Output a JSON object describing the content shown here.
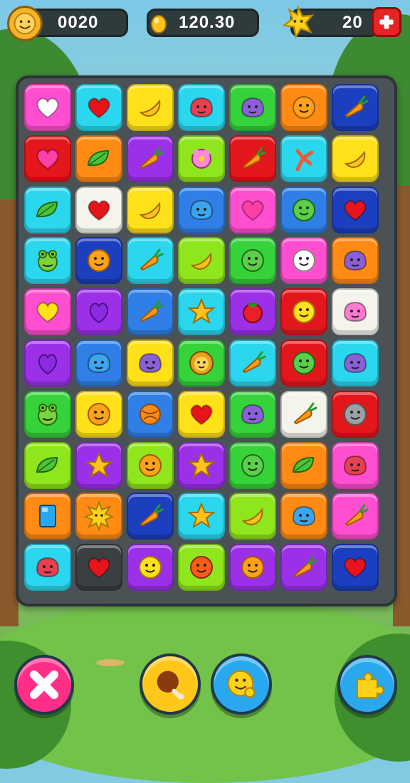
{
  "hud": {
    "score": "0020",
    "coins": "120.30",
    "moves": "20"
  },
  "colors": {
    "pink": "#ff4fd0",
    "cyan": "#2bd7ef",
    "yellow": "#ffe11a",
    "green": "#8fe61c",
    "orange": "#ff8a14",
    "navy": "#1c3fbf",
    "red": "#e3161c",
    "purple": "#9b30e8",
    "white": "#f4f4ec",
    "blue": "#2f7fe6",
    "dark": "#3a3f42",
    "lime": "#36d23a"
  },
  "grid": [
    [
      [
        "pink",
        "heart-white-icon"
      ],
      [
        "cyan",
        "heart-red-icon"
      ],
      [
        "yellow",
        "banana-icon"
      ],
      [
        "cyan",
        "red-blob-icon"
      ],
      [
        "lime",
        "purple-blob-icon"
      ],
      [
        "orange",
        "orange-face-icon"
      ],
      [
        "navy",
        "carrot-icon"
      ]
    ],
    [
      [
        "red",
        "heart-pink-icon"
      ],
      [
        "orange",
        "leaf-icon"
      ],
      [
        "purple",
        "carrot-icon"
      ],
      [
        "green",
        "flower-icon"
      ],
      [
        "red",
        "carrot-icon"
      ],
      [
        "cyan",
        "branch-icon"
      ],
      [
        "yellow",
        "banana-icon"
      ]
    ],
    [
      [
        "cyan",
        "leaf-icon"
      ],
      [
        "white",
        "heart-red-icon"
      ],
      [
        "yellow",
        "banana-icon"
      ],
      [
        "blue",
        "blue-blob-icon"
      ],
      [
        "pink",
        "heart-pink-icon"
      ],
      [
        "blue",
        "green-face-icon"
      ],
      [
        "navy",
        "heart-red-icon"
      ]
    ],
    [
      [
        "cyan",
        "frog-icon"
      ],
      [
        "navy",
        "orange-face-icon"
      ],
      [
        "cyan",
        "carrot-icon"
      ],
      [
        "green",
        "banana-icon"
      ],
      [
        "lime",
        "green-face-icon"
      ],
      [
        "pink",
        "white-face-icon"
      ],
      [
        "orange",
        "purple-blob-icon"
      ]
    ],
    [
      [
        "pink",
        "heart-yellow-icon"
      ],
      [
        "purple",
        "heart-purple-icon"
      ],
      [
        "blue",
        "carrot-icon"
      ],
      [
        "cyan",
        "star-icon"
      ],
      [
        "purple",
        "tomato-icon"
      ],
      [
        "red",
        "yellow-face-icon"
      ],
      [
        "white",
        "pink-blob-icon"
      ]
    ],
    [
      [
        "purple",
        "heart-purple-icon"
      ],
      [
        "blue",
        "blue-blob-icon"
      ],
      [
        "yellow",
        "purple-blob-icon"
      ],
      [
        "lime",
        "lion-icon"
      ],
      [
        "cyan",
        "carrot-icon"
      ],
      [
        "red",
        "green-face-icon"
      ],
      [
        "cyan",
        "purple-blob-icon"
      ]
    ],
    [
      [
        "lime",
        "frog-icon"
      ],
      [
        "yellow",
        "orange-face-icon"
      ],
      [
        "blue",
        "orange-ball-icon"
      ],
      [
        "yellow",
        "heart-red-icon"
      ],
      [
        "lime",
        "purple-blob-icon"
      ],
      [
        "white",
        "carrot-icon"
      ],
      [
        "red",
        "grey-face-icon"
      ]
    ],
    [
      [
        "green",
        "leaf-icon"
      ],
      [
        "purple",
        "star-icon"
      ],
      [
        "green",
        "orange-face-icon"
      ],
      [
        "purple",
        "star-icon"
      ],
      [
        "lime",
        "green-face-icon"
      ],
      [
        "orange",
        "leaf-icon"
      ],
      [
        "pink",
        "red-blob-icon"
      ]
    ],
    [
      [
        "orange",
        "blue-card-icon"
      ],
      [
        "orange",
        "sun-icon"
      ],
      [
        "navy",
        "carrot-icon"
      ],
      [
        "cyan",
        "star-icon"
      ],
      [
        "green",
        "banana-icon"
      ],
      [
        "orange",
        "blue-blob-icon"
      ],
      [
        "pink",
        "carrot-icon"
      ]
    ],
    [
      [
        "cyan",
        "red-blob-icon"
      ],
      [
        "dark",
        "heart-red-icon"
      ],
      [
        "purple",
        "yellow-face-icon"
      ],
      [
        "green",
        "red-face-icon"
      ],
      [
        "purple",
        "orange-face-icon"
      ],
      [
        "purple",
        "carrot-icon"
      ],
      [
        "navy",
        "heart-red-icon"
      ]
    ]
  ],
  "buttons": [
    {
      "name": "close-button",
      "icon": "x-icon"
    },
    {
      "name": "hammer-booster-button",
      "icon": "drumstick-icon"
    },
    {
      "name": "hint-booster-button",
      "icon": "smiley-icon"
    },
    {
      "name": "shuffle-booster-button",
      "icon": "puzzle-icon"
    }
  ]
}
